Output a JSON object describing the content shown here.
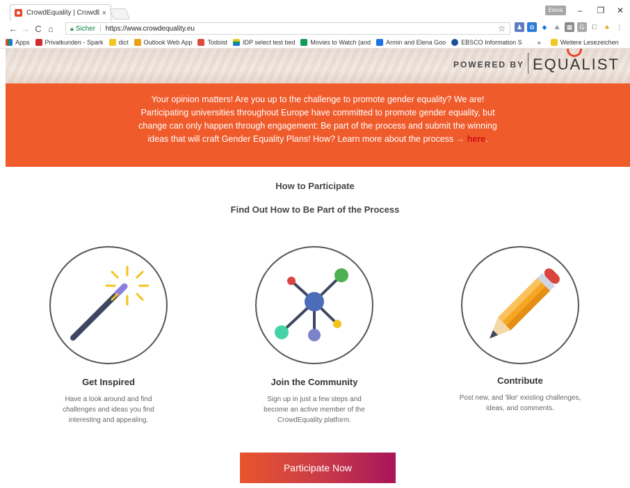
{
  "browser": {
    "tab_title": "CrowdEquality | CrowdEq",
    "tab_close": "×",
    "profile": "Elena",
    "secure_label": "Sicher",
    "url": "https://www.crowdequality.eu",
    "bookmarks": [
      {
        "label": "Apps",
        "color": "#e8462a"
      },
      {
        "label": "Privatkunden - Spark",
        "color": "#d22b2b"
      },
      {
        "label": "dict",
        "color": "#f3c623"
      },
      {
        "label": "Outlook Web App",
        "color": "#e8a217"
      },
      {
        "label": "Todoist",
        "color": "#db4c3f"
      },
      {
        "label": "IDP select test bed",
        "color": "#2c7a3c"
      },
      {
        "label": "Movies to Watch (and",
        "color": "#0f9d58"
      },
      {
        "label": "Armin and Elena Goo",
        "color": "#1a73e8"
      },
      {
        "label": "EBSCO Information S",
        "color": "#1e4f9a"
      }
    ],
    "bookmarks_more": "»",
    "other_bookmarks": "Weitere Lesezeichen"
  },
  "hero": {
    "powered_by": "POWERED BY",
    "brand": "EQUALIST"
  },
  "banner": {
    "text": "Your opinion matters! Are you up to the challenge to promote gender equality? We are! Participating universities throughout Europe have committed to promote gender equality, but change can only happen through engagement: Be part of the process and submit the winning ideas that will craft Gender Equality Plans! How? Learn more about the process",
    "arrow": "→",
    "link": "here",
    "end": "."
  },
  "section": {
    "heading": "How to Participate",
    "subheading": "Find Out How to Be Part of the Process"
  },
  "steps": [
    {
      "icon": "magic-wand-icon",
      "title": "Get Inspired",
      "desc": "Have a look around and find challenges and ideas you find interesting and appealing."
    },
    {
      "icon": "network-icon",
      "title": "Join the Community",
      "desc": "Sign up in just a few steps and become an active member of the CrowdEquality platform."
    },
    {
      "icon": "pencil-icon",
      "title": "Contribute",
      "desc": "Post new, and 'like' existing challenges, ideas, and comments."
    }
  ],
  "cta": {
    "label": "Participate Now"
  },
  "colors": {
    "accent": "#ef5b2b",
    "link": "#d31016",
    "cta_end": "#a8145a"
  }
}
